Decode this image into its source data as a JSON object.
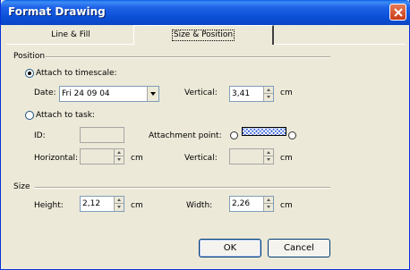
{
  "window": {
    "title": "Format Drawing"
  },
  "tabs": [
    {
      "label": "Line & Fill"
    },
    {
      "label": "Size & Position"
    }
  ],
  "position": {
    "section_label": "Position",
    "attach_timescale_label": "Attach to timescale:",
    "date_label": "Date:",
    "date_value": "Fri 24 09 04",
    "vertical_label": "Vertical:",
    "vertical_value": "3,41",
    "vertical_unit": "cm",
    "attach_task_label": "Attach to task:",
    "id_label": "ID:",
    "id_value": "",
    "attachment_point_label": "Attachment point:",
    "horizontal_label": "Horizontal:",
    "horizontal_value": "",
    "horizontal_unit": "cm",
    "task_vertical_label": "Vertical:",
    "task_vertical_value": "",
    "task_vertical_unit": "cm"
  },
  "size": {
    "section_label": "Size",
    "height_label": "Height:",
    "height_value": "2,12",
    "height_unit": "cm",
    "width_label": "Width:",
    "width_value": "2,26",
    "width_unit": "cm"
  },
  "buttons": {
    "ok": "OK",
    "cancel": "Cancel"
  },
  "colors": {
    "title_bar": "#0a4fd6",
    "accent_hatch": "#3b66d8",
    "dialog_bg": "#ece9d8"
  }
}
